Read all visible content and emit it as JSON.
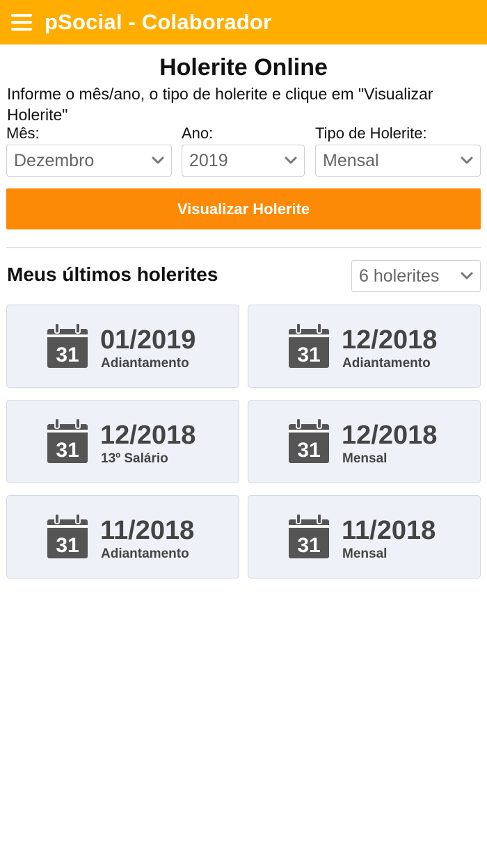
{
  "header": {
    "menu_icon": "hamburger-menu-icon",
    "title": "pSocial - Colaborador",
    "background_color": "#ffad00"
  },
  "page": {
    "title": "Holerite Online",
    "instructions": "Informe o mês/ano, o tipo de holerite e clique em \"Visualizar Holerite\""
  },
  "form": {
    "month_label": "Mês:",
    "month_value": "Dezembro",
    "year_label": "Ano:",
    "year_value": "2019",
    "type_label": "Tipo de Holerite:",
    "type_value": "Mensal",
    "submit_label": "Visualizar Holerite",
    "submit_color": "#fd8a06"
  },
  "recent": {
    "title": "Meus últimos holerites",
    "count_value": "6 holerites",
    "calendar_icon": "calendar-icon",
    "calendar_day": "31",
    "items": [
      {
        "date": "01/2019",
        "type": "Adiantamento"
      },
      {
        "date": "12/2018",
        "type": "Adiantamento"
      },
      {
        "date": "12/2018",
        "type": "13º Salário"
      },
      {
        "date": "12/2018",
        "type": "Mensal"
      },
      {
        "date": "11/2018",
        "type": "Adiantamento"
      },
      {
        "date": "11/2018",
        "type": "Mensal"
      }
    ]
  }
}
